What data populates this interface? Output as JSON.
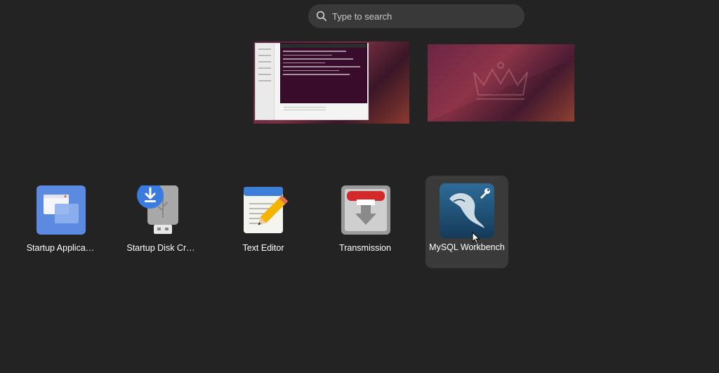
{
  "search": {
    "placeholder": "Type to search",
    "icon": "search-icon"
  },
  "apps": [
    {
      "label": "Startup Applica…",
      "icon": "startup-applications-icon",
      "color": "#5b8ae0"
    },
    {
      "label": "Startup Disk Cr…",
      "icon": "startup-disk-creator-icon",
      "color": "#4a86e8"
    },
    {
      "label": "Text Editor",
      "icon": "text-editor-icon",
      "color": "#3d7fd8"
    },
    {
      "label": "Transmission",
      "icon": "transmission-icon",
      "color": "#d22a2a"
    },
    {
      "label": "MySQL Workbench",
      "icon": "mysql-workbench-icon",
      "color": "#1f4f74",
      "selected": true
    }
  ],
  "colors": {
    "background": "#232323",
    "search_bg": "#393939",
    "selected_tile": "#3a3a3a"
  }
}
